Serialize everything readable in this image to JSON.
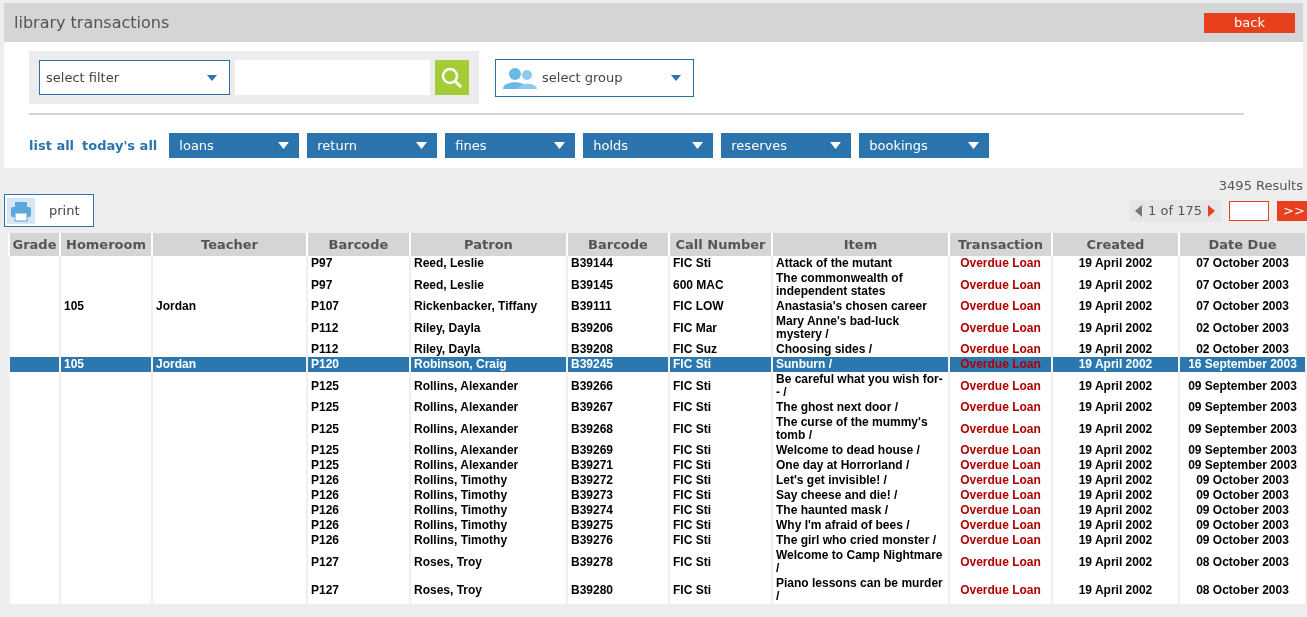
{
  "title": "library transactions",
  "back_button": "back",
  "filter": {
    "select": "select filter",
    "group_select": "select group"
  },
  "quick_links": [
    "list all",
    "today's all"
  ],
  "dropdowns": [
    "loans",
    "return",
    "fines",
    "holds",
    "reserves",
    "bookings"
  ],
  "results": "3495 Results",
  "print_button": "print",
  "pagination": {
    "page": "1 of 175",
    "prev_disabled": true,
    "next_disabled": false,
    "go_button": ">>"
  },
  "table": {
    "columns": [
      "Grade",
      "Homeroom",
      "Teacher",
      "Barcode",
      "Patron",
      "Barcode",
      "Call Number",
      "Item",
      "Transaction",
      "Created",
      "Date Due"
    ],
    "rows": [
      {
        "selected": false,
        "homeroom": "",
        "teacher": "",
        "patron_barcode": "P97",
        "patron": "Reed, Leslie",
        "barcode": "B39144",
        "call_number": "FIC Sti",
        "item": "Attack of the mutant",
        "transaction": "Overdue Loan",
        "created": "19 April 2002",
        "date_due": "07 October 2003"
      },
      {
        "selected": false,
        "homeroom": "",
        "teacher": "",
        "patron_barcode": "P97",
        "patron": "Reed, Leslie",
        "barcode": "B39145",
        "call_number": "600 MAC",
        "item": "The commonwealth of independent states",
        "transaction": "Overdue Loan",
        "created": "19 April 2002",
        "date_due": "07 October 2003"
      },
      {
        "selected": false,
        "homeroom": "105",
        "teacher": "Jordan",
        "patron_barcode": "P107",
        "patron": "Rickenbacker, Tiffany",
        "barcode": "B39111",
        "call_number": "FIC LOW",
        "item": "Anastasia's chosen career",
        "transaction": "Overdue Loan",
        "created": "19 April 2002",
        "date_due": "07 October 2003"
      },
      {
        "selected": false,
        "homeroom": "",
        "teacher": "",
        "patron_barcode": "P112",
        "patron": "Riley, Dayla",
        "barcode": "B39206",
        "call_number": "FIC Mar",
        "item": "Mary Anne's bad-luck mystery /",
        "transaction": "Overdue Loan",
        "created": "19 April 2002",
        "date_due": "02 October 2003"
      },
      {
        "selected": false,
        "homeroom": "",
        "teacher": "",
        "patron_barcode": "P112",
        "patron": "Riley, Dayla",
        "barcode": "B39208",
        "call_number": "FIC Suz",
        "item": "Choosing sides /",
        "transaction": "Overdue Loan",
        "created": "19 April 2002",
        "date_due": "02 October 2003"
      },
      {
        "selected": true,
        "homeroom": "105",
        "teacher": "Jordan",
        "patron_barcode": "P120",
        "patron": "Robinson, Craig",
        "barcode": "B39245",
        "call_number": "FIC Sti",
        "item": "Sunburn /",
        "transaction": "Overdue Loan",
        "created": "19 April 2002",
        "date_due": "16 September 2003"
      },
      {
        "selected": false,
        "homeroom": "",
        "teacher": "",
        "patron_barcode": "P125",
        "patron": "Rollins, Alexander",
        "barcode": "B39266",
        "call_number": "FIC Sti",
        "item": "Be careful what you wish for-- /",
        "transaction": "Overdue Loan",
        "created": "19 April 2002",
        "date_due": "09 September 2003"
      },
      {
        "selected": false,
        "homeroom": "",
        "teacher": "",
        "patron_barcode": "P125",
        "patron": "Rollins, Alexander",
        "barcode": "B39267",
        "call_number": "FIC Sti",
        "item": "The ghost next door /",
        "transaction": "Overdue Loan",
        "created": "19 April 2002",
        "date_due": "09 September 2003"
      },
      {
        "selected": false,
        "homeroom": "",
        "teacher": "",
        "patron_barcode": "P125",
        "patron": "Rollins, Alexander",
        "barcode": "B39268",
        "call_number": "FIC Sti",
        "item": "The curse of the mummy's tomb /",
        "transaction": "Overdue Loan",
        "created": "19 April 2002",
        "date_due": "09 September 2003"
      },
      {
        "selected": false,
        "homeroom": "",
        "teacher": "",
        "patron_barcode": "P125",
        "patron": "Rollins, Alexander",
        "barcode": "B39269",
        "call_number": "FIC Sti",
        "item": "Welcome to dead house /",
        "transaction": "Overdue Loan",
        "created": "19 April 2002",
        "date_due": "09 September 2003"
      },
      {
        "selected": false,
        "homeroom": "",
        "teacher": "",
        "patron_barcode": "P125",
        "patron": "Rollins, Alexander",
        "barcode": "B39271",
        "call_number": "FIC Sti",
        "item": "One day at Horrorland /",
        "transaction": "Overdue Loan",
        "created": "19 April 2002",
        "date_due": "09 September 2003"
      },
      {
        "selected": false,
        "homeroom": "",
        "teacher": "",
        "patron_barcode": "P126",
        "patron": "Rollins, Timothy",
        "barcode": "B39272",
        "call_number": "FIC Sti",
        "item": "Let's get invisible! /",
        "transaction": "Overdue Loan",
        "created": "19 April 2002",
        "date_due": "09 October 2003"
      },
      {
        "selected": false,
        "homeroom": "",
        "teacher": "",
        "patron_barcode": "P126",
        "patron": "Rollins, Timothy",
        "barcode": "B39273",
        "call_number": "FIC Sti",
        "item": "Say cheese and die! /",
        "transaction": "Overdue Loan",
        "created": "19 April 2002",
        "date_due": "09 October 2003"
      },
      {
        "selected": false,
        "homeroom": "",
        "teacher": "",
        "patron_barcode": "P126",
        "patron": "Rollins, Timothy",
        "barcode": "B39274",
        "call_number": "FIC Sti",
        "item": "The haunted mask /",
        "transaction": "Overdue Loan",
        "created": "19 April 2002",
        "date_due": "09 October 2003"
      },
      {
        "selected": false,
        "homeroom": "",
        "teacher": "",
        "patron_barcode": "P126",
        "patron": "Rollins, Timothy",
        "barcode": "B39275",
        "call_number": "FIC Sti",
        "item": "Why I'm afraid of bees /",
        "transaction": "Overdue Loan",
        "created": "19 April 2002",
        "date_due": "09 October 2003"
      },
      {
        "selected": false,
        "homeroom": "",
        "teacher": "",
        "patron_barcode": "P126",
        "patron": "Rollins, Timothy",
        "barcode": "B39276",
        "call_number": "FIC Sti",
        "item": "The girl who cried monster /",
        "transaction": "Overdue Loan",
        "created": "19 April 2002",
        "date_due": "09 October 2003"
      },
      {
        "selected": false,
        "homeroom": "",
        "teacher": "",
        "patron_barcode": "P127",
        "patron": "Roses, Troy",
        "barcode": "B39278",
        "call_number": "FIC Sti",
        "item": "Welcome to Camp Nightmare /",
        "transaction": "Overdue Loan",
        "created": "19 April 2002",
        "date_due": "08 October 2003"
      },
      {
        "selected": false,
        "homeroom": "",
        "teacher": "",
        "patron_barcode": "P127",
        "patron": "Roses, Troy",
        "barcode": "B39280",
        "call_number": "FIC Sti",
        "item": "Piano lessons can be murder /",
        "transaction": "Overdue Loan",
        "created": "19 April 2002",
        "date_due": "08 October 2003"
      }
    ]
  }
}
